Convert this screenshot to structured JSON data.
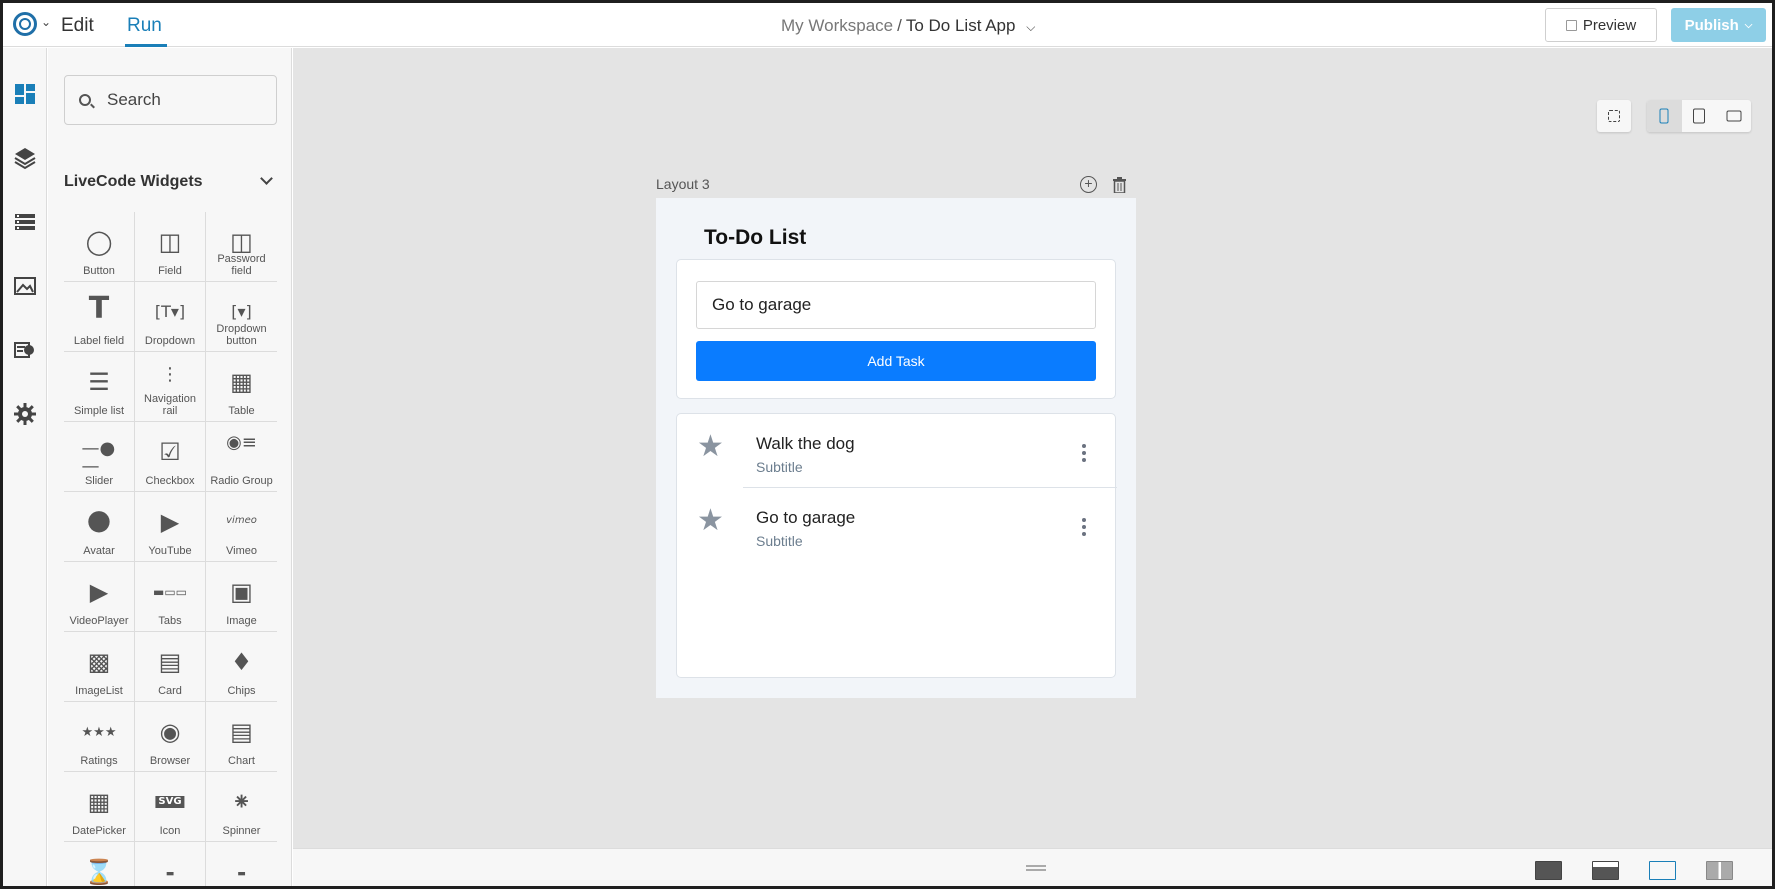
{
  "header": {
    "tabs": [
      {
        "label": "Edit",
        "active": false
      },
      {
        "label": "Run",
        "active": true
      }
    ],
    "breadcrumb": {
      "workspace": "My Workspace",
      "separator": "/",
      "app": "To Do List App"
    },
    "preview_label": "Preview",
    "publish_label": "Publish",
    "accent_color": "#1a7fb8"
  },
  "rail": {
    "icons": [
      "widgets-icon",
      "layers-icon",
      "data-icon",
      "media-icon",
      "api-icon",
      "settings-icon"
    ]
  },
  "panel": {
    "search": {
      "value": "",
      "placeholder": "Search"
    },
    "section_title": "LiveCode Widgets",
    "widgets": [
      {
        "label": "Button",
        "icon": "button-icon"
      },
      {
        "label": "Field",
        "icon": "field-icon"
      },
      {
        "label": "Password field",
        "icon": "password-field-icon"
      },
      {
        "label": "Label field",
        "icon": "label-field-icon"
      },
      {
        "label": "Dropdown",
        "icon": "dropdown-icon"
      },
      {
        "label": "Dropdown button",
        "icon": "dropdown-button-icon"
      },
      {
        "label": "Simple list",
        "icon": "simple-list-icon"
      },
      {
        "label": "Navigation rail",
        "icon": "navigation-rail-icon"
      },
      {
        "label": "Table",
        "icon": "table-icon"
      },
      {
        "label": "Slider",
        "icon": "slider-icon"
      },
      {
        "label": "Checkbox",
        "icon": "checkbox-icon"
      },
      {
        "label": "Radio Group",
        "icon": "radio-group-icon"
      },
      {
        "label": "Avatar",
        "icon": "avatar-icon"
      },
      {
        "label": "YouTube",
        "icon": "youtube-icon"
      },
      {
        "label": "Vimeo",
        "icon": "vimeo-icon"
      },
      {
        "label": "VideoPlayer",
        "icon": "video-player-icon"
      },
      {
        "label": "Tabs",
        "icon": "tabs-icon"
      },
      {
        "label": "Image",
        "icon": "image-icon"
      },
      {
        "label": "ImageList",
        "icon": "image-list-icon"
      },
      {
        "label": "Card",
        "icon": "card-icon"
      },
      {
        "label": "Chips",
        "icon": "chips-icon"
      },
      {
        "label": "Ratings",
        "icon": "ratings-icon"
      },
      {
        "label": "Browser",
        "icon": "browser-icon"
      },
      {
        "label": "Chart",
        "icon": "chart-icon"
      },
      {
        "label": "DatePicker",
        "icon": "date-picker-icon"
      },
      {
        "label": "Icon",
        "icon": "icon-widget-icon"
      },
      {
        "label": "Spinner",
        "icon": "spinner-icon"
      },
      {
        "label": "",
        "icon": "timer-icon"
      },
      {
        "label": "",
        "icon": "title-bar-icon"
      },
      {
        "label": "",
        "icon": "segmented-icon"
      }
    ]
  },
  "canvas": {
    "layout_label": "Layout 3",
    "app": {
      "title": "To-Do List",
      "task_input": {
        "value": "Go to garage",
        "placeholder": ""
      },
      "add_button_label": "Add Task",
      "add_button_color": "#0a7cff",
      "tasks": [
        {
          "title": "Walk the dog",
          "subtitle": "Subtitle"
        },
        {
          "title": "Go to garage",
          "subtitle": "Subtitle"
        }
      ]
    },
    "device_options": [
      "mobile-icon",
      "tablet-icon",
      "desktop-icon"
    ],
    "selected_device": "mobile-icon"
  },
  "bottombar": {
    "layout_modes": [
      "layout-full-icon",
      "layout-bar-icon",
      "layout-outline-icon",
      "layout-split-icon"
    ],
    "selected_mode": "layout-outline-icon"
  }
}
